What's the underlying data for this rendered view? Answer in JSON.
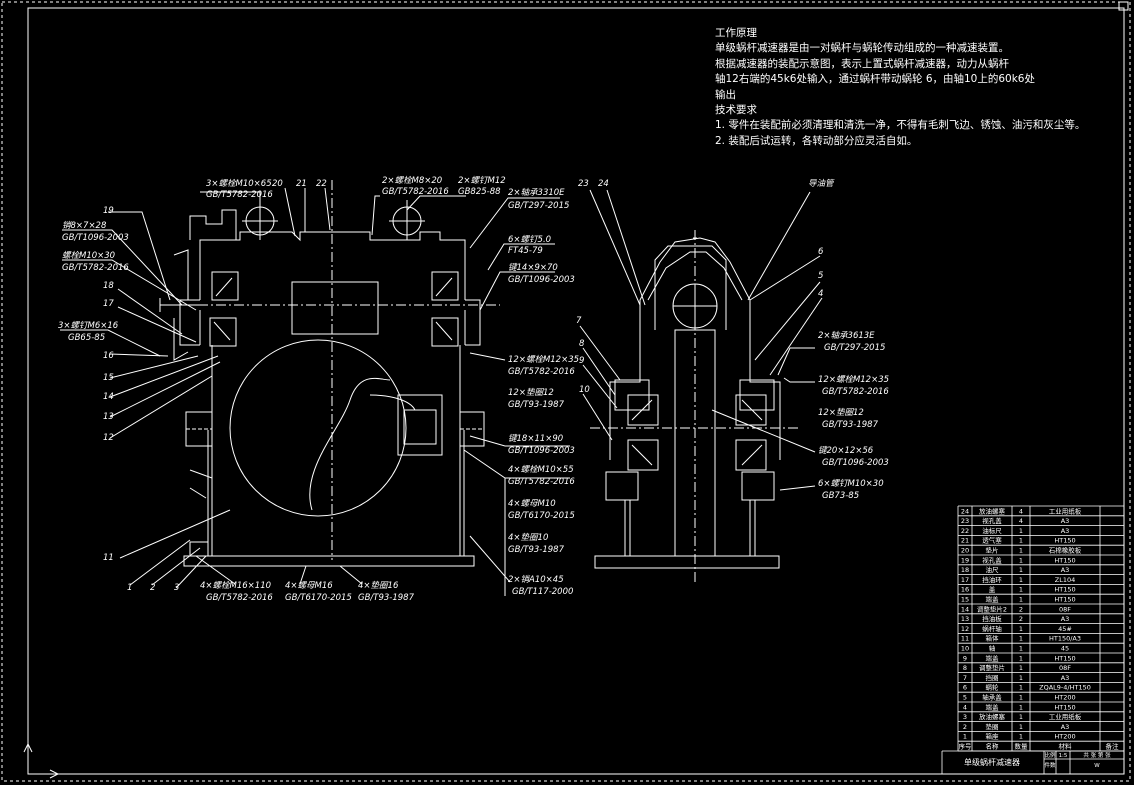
{
  "colors": {
    "background": "#000000",
    "line": "#ffffff",
    "frame": "#ffffff"
  },
  "notes": {
    "title": "工作原理",
    "lines": [
      "单级蜗杆减速器是由一对蜗杆与蜗轮传动组成的一种减速装置。",
      "根据减速器的装配示意图，表示上置式蜗杆减速器，动力从蜗杆",
      "轴12右端的45k6处输入，通过蜗杆带动蜗轮 6，由轴10上的60k6处",
      "输出"
    ],
    "req_title": "技术要求",
    "req_lines": [
      "1. 零件在装配前必须清理和清洗一净，不得有毛刺飞边、锈蚀、油污和灰尘等。",
      "2. 装配后试运转，各转动部分应灵活自如。"
    ]
  },
  "callouts": {
    "front_top": [
      "3×螺栓M10×65",
      "GB/T5782-2016",
      "20",
      "21",
      "22",
      "2×螺栓M8×20",
      "GB/T5782-2016",
      "2×螺钉M12",
      "GB825-88",
      "2×轴承3310E",
      "GB/T297-2015"
    ],
    "front_left": [
      "19",
      "销8×7×28",
      "GB/T1096-2003",
      "螺栓M10×30",
      "GB/T5782-2016",
      "18",
      "17",
      "3×螺钉M6×16",
      "GB65-85",
      "16",
      "15",
      "14",
      "13",
      "12",
      "11"
    ],
    "front_right": [
      "6×螺钉5.0",
      "FT45-79",
      "键14×9×70",
      "GB/T1096-2003",
      "12×螺栓M12×35",
      "GB/T5782-2016",
      "12×垫圈12",
      "GB/T93-1987",
      "键18×11×90",
      "GB/T1096-2003",
      "4×螺栓M10×55",
      "GB/T5782-2016",
      "4×螺母M10",
      "GB/T6170-2015",
      "4×垫圈10",
      "GB/T93-1987",
      "2×销A10×45",
      "GB/T117-2000"
    ],
    "front_bottom": [
      "1",
      "2",
      "3",
      "4×螺栓M16×110",
      "GB/T5782-2016",
      "4×螺母M16",
      "GB/T6170-2015",
      "4×垫圈16",
      "GB/T93-1987"
    ],
    "side": [
      "23",
      "24",
      "导油管",
      "6",
      "5",
      "4",
      "7",
      "8",
      "9",
      "10",
      "2×轴承3613E",
      "GB/T297-2015",
      "12×螺栓M12×35",
      "GB/T5782-2016",
      "12×垫圈12",
      "GB/T93-1987",
      "键20×12×56",
      "GB/T1096-2003",
      "6×螺钉M10×30",
      "GB73-85"
    ]
  },
  "bom": {
    "rows": [
      [
        "24",
        "放油螺塞",
        "4",
        "工业用纸板"
      ],
      [
        "23",
        "视孔盖",
        "4",
        "A3"
      ],
      [
        "22",
        "油标尺",
        "1",
        "A3"
      ],
      [
        "21",
        "透气塞",
        "1",
        "HT150"
      ],
      [
        "20",
        "垫片",
        "1",
        "石棉橡胶板"
      ],
      [
        "19",
        "视孔盖",
        "1",
        "HT150"
      ],
      [
        "18",
        "油尺",
        "1",
        "A3"
      ],
      [
        "17",
        "挡油环",
        "1",
        "ZL104"
      ],
      [
        "16",
        "盖",
        "1",
        "HT150"
      ],
      [
        "15",
        "端盖",
        "1",
        "HT150"
      ],
      [
        "14",
        "调整垫片2",
        "2",
        "08F"
      ],
      [
        "13",
        "挡油板",
        "2",
        "A3"
      ],
      [
        "12",
        "蜗杆轴",
        "1",
        "45#"
      ],
      [
        "11",
        "箱体",
        "1",
        "HT150/A3"
      ],
      [
        "10",
        "轴",
        "1",
        "45"
      ],
      [
        "9",
        "端盖",
        "1",
        "HT150"
      ],
      [
        "8",
        "调整垫片",
        "1",
        "08F"
      ],
      [
        "7",
        "挡圈",
        "1",
        "A3"
      ],
      [
        "6",
        "蜗轮",
        "1",
        "ZQAL9-4/HT150"
      ],
      [
        "5",
        "轴承盖",
        "1",
        "HT200"
      ],
      [
        "4",
        "端盖",
        "1",
        "HT150"
      ],
      [
        "3",
        "放油螺塞",
        "1",
        "工业用纸板"
      ],
      [
        "2",
        "垫圈",
        "1",
        "A3"
      ],
      [
        "1",
        "箱座",
        "1",
        "HT200"
      ]
    ],
    "header": [
      "序号",
      "名称",
      "数量",
      "材料",
      "备注"
    ],
    "title": "单级蜗杆减速器",
    "info": [
      "比例",
      "1:5",
      "共 张 第 张",
      "件数",
      "W"
    ]
  }
}
